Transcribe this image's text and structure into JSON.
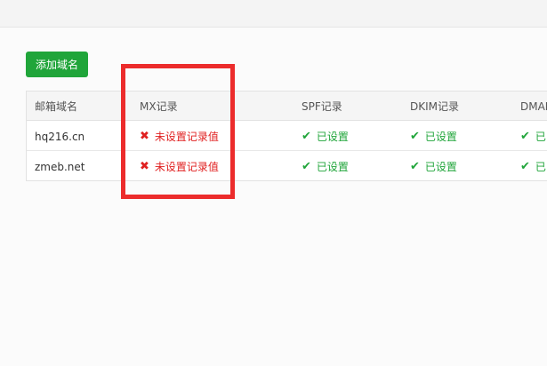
{
  "toolbar": {
    "add_domain_label": "添加域名"
  },
  "table": {
    "headers": {
      "domain": "邮箱域名",
      "mx": "MX记录",
      "spf": "SPF记录",
      "dkim": "DKIM记录",
      "dmarc": "DMARC"
    },
    "rows": [
      {
        "domain": "hq216.cn",
        "mx": "未设置记录值",
        "spf": "已设置",
        "dkim": "已设置",
        "dmarc": "已"
      },
      {
        "domain": "zmeb.net",
        "mx": "未设置记录值",
        "spf": "已设置",
        "dkim": "已设置",
        "dmarc": "已"
      }
    ]
  },
  "icons": {
    "error": "x-icon",
    "ok": "check-icon"
  },
  "colors": {
    "accent": "#20a53a",
    "error": "#e02020",
    "highlight": "#ec2c2c"
  }
}
